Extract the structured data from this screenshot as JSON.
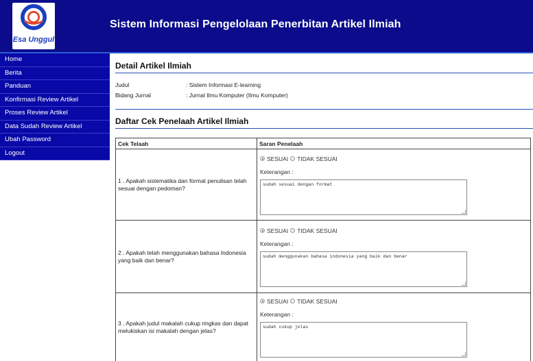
{
  "header": {
    "logo_text": "Esa Unggul",
    "title": "Sistem Informasi Pengelolaan Penerbitan Artikel Ilmiah"
  },
  "sidebar": {
    "items": [
      {
        "label": "Home"
      },
      {
        "label": "Berita"
      },
      {
        "label": "Panduan"
      },
      {
        "label": "Konfirmasi Review Artikel"
      },
      {
        "label": "Proses Review Artikel"
      },
      {
        "label": "Data Sudah Review Artikel"
      },
      {
        "label": "Ubah Password"
      },
      {
        "label": "Logout"
      }
    ]
  },
  "detail": {
    "title": "Detail Artikel Ilmiah",
    "judul_label": "Judul",
    "judul_value": ": Sistem Informasi E-learning",
    "bidang_label": "Bidang Jurnal",
    "bidang_value": ": Jurnal Ilmu Komputer (Ilmu Komputer)"
  },
  "checklist": {
    "title": "Daftar Cek Penelaah Artikel Ilmiah",
    "col_check": "Cek Telaah",
    "col_advice": "Saran Penelaah",
    "opt_yes": "SESUAI",
    "opt_no": "TIDAK SESUAI",
    "ket_label": "Keterangan :",
    "rows": [
      {
        "question": "1 . Apakah sistematika dan format penulisan telah sesuai dengan pedoman?",
        "note": "sudah sesuai dengan format",
        "selected": "SESUAI"
      },
      {
        "question": "2 . Apakah telah menggunakan bahasa Indonesia yang baik dan benar?",
        "note": "sudah menggunakan bahasa indonesia yang baik dan benar",
        "selected": "SESUAI"
      },
      {
        "question": "3 . Apakah judul makalah cukup ringkas dan dapat melukiskan isi makalah dengan jelas?",
        "note": "sudah cukup jelas",
        "selected": "SESUAI"
      }
    ]
  },
  "colors": {
    "header_bg": "#0b0b8c",
    "sidebar_bg": "#0909a8",
    "accent_line": "#2a4fb0"
  }
}
